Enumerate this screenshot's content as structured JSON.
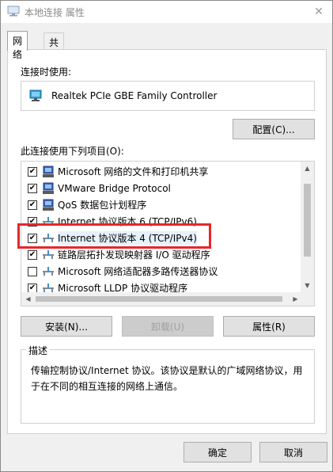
{
  "window": {
    "title": "本地连接 属性",
    "close_glyph": "✕"
  },
  "tabs": [
    {
      "label": "网络",
      "active": true
    },
    {
      "label": "共享",
      "active": false
    }
  ],
  "connect_using": {
    "label": "连接时使用:",
    "adapter_name": "Realtek PCIe GBE Family Controller",
    "configure_button": "配置(C)..."
  },
  "items": {
    "label": "此连接使用下列项目(O):",
    "list": [
      {
        "label": "Microsoft 网络的文件和打印机共享",
        "checked": true,
        "icon": "network-client-icon"
      },
      {
        "label": "VMware Bridge Protocol",
        "checked": true,
        "icon": "network-client-icon"
      },
      {
        "label": "QoS 数据包计划程序",
        "checked": true,
        "icon": "network-client-icon"
      },
      {
        "label": "Internet 协议版本 6 (TCP/IPv6)",
        "checked": true,
        "icon": "protocol-icon"
      },
      {
        "label": "Internet 协议版本 4 (TCP/IPv4)",
        "checked": true,
        "icon": "protocol-icon",
        "selected": true
      },
      {
        "label": "链路层拓扑发现映射器 I/O 驱动程序",
        "checked": true,
        "icon": "protocol-icon"
      },
      {
        "label": "Microsoft 网络适配器多路传送器协议",
        "checked": false,
        "icon": "protocol-icon"
      },
      {
        "label": "Microsoft LLDP 协议驱动程序",
        "checked": true,
        "icon": "protocol-icon"
      }
    ],
    "install_button": "安装(N)...",
    "uninstall_button": "卸载(U)",
    "properties_button": "属性(R)"
  },
  "description": {
    "title": "描述",
    "text": "传输控制协议/Internet 协议。该协议是默认的广域网络协议，用于在不同的相互连接的网络上通信。"
  },
  "footer": {
    "ok_button": "确定",
    "cancel_button": "取消"
  },
  "colors": {
    "highlight": "#e8262b"
  }
}
